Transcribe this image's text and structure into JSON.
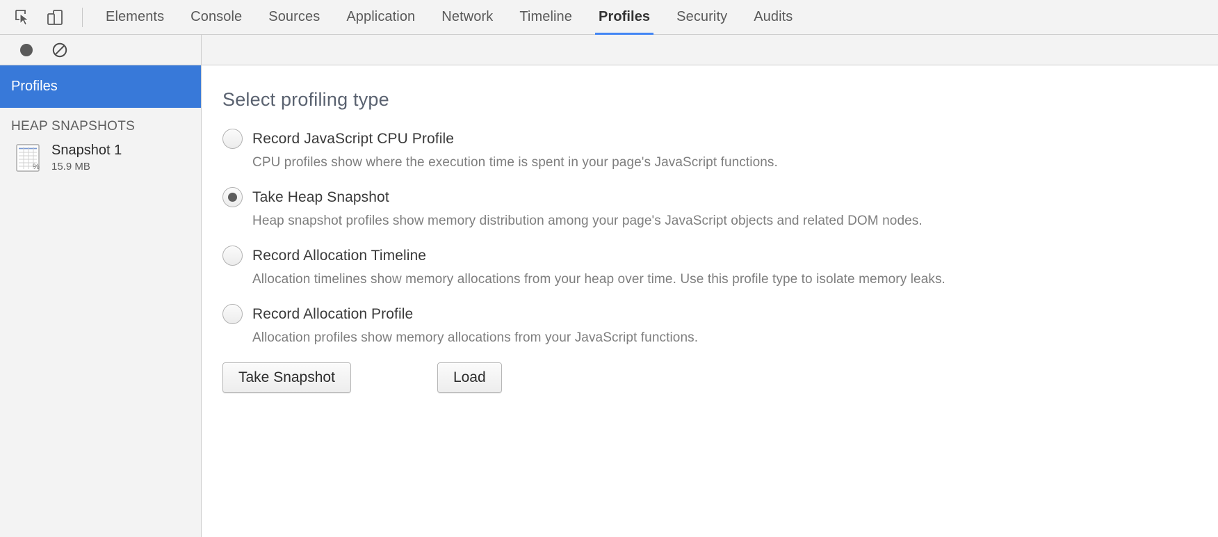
{
  "toolbar": {
    "inspect_icon": "inspect-element-cursor-icon",
    "device_icon": "toggle-device-toolbar-icon",
    "record_icon": "record-circle-icon",
    "clear_icon": "clear-all-profiles-icon",
    "tabs": [
      {
        "label": "Elements",
        "active": false
      },
      {
        "label": "Console",
        "active": false
      },
      {
        "label": "Sources",
        "active": false
      },
      {
        "label": "Application",
        "active": false
      },
      {
        "label": "Network",
        "active": false
      },
      {
        "label": "Timeline",
        "active": false
      },
      {
        "label": "Profiles",
        "active": true
      },
      {
        "label": "Security",
        "active": false
      },
      {
        "label": "Audits",
        "active": false
      }
    ],
    "active_tab_accent": "#4285f4"
  },
  "sidebar": {
    "selected_item": "Profiles",
    "selected_background": "#3879d9",
    "section_header": "HEAP SNAPSHOTS",
    "snapshots": [
      {
        "icon": "heap-snapshot-icon",
        "title": "Snapshot 1",
        "size": "15.9 MB"
      }
    ]
  },
  "main": {
    "title": "Select profiling type",
    "options": [
      {
        "label": "Record JavaScript CPU Profile",
        "description": "CPU profiles show where the execution time is spent in your page's JavaScript functions.",
        "selected": false
      },
      {
        "label": "Take Heap Snapshot",
        "description": "Heap snapshot profiles show memory distribution among your page's JavaScript objects and related DOM nodes.",
        "selected": true
      },
      {
        "label": "Record Allocation Timeline",
        "description": "Allocation timelines show memory allocations from your heap over time. Use this profile type to isolate memory leaks.",
        "selected": false
      },
      {
        "label": "Record Allocation Profile",
        "description": "Allocation profiles show memory allocations from your JavaScript functions.",
        "selected": false
      }
    ],
    "buttons": {
      "primary": "Take Snapshot",
      "secondary": "Load"
    }
  }
}
